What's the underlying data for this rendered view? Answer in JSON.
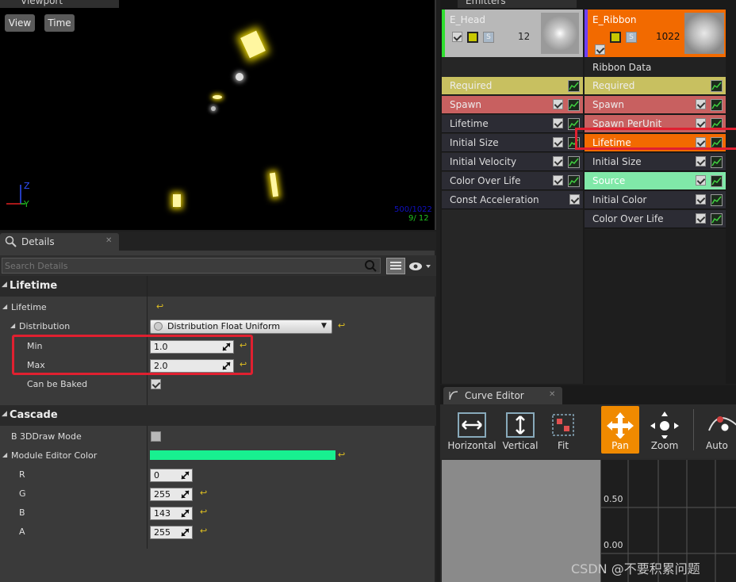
{
  "viewport": {
    "tab": "Viewport",
    "view_btn": "View",
    "time_btn": "Time",
    "stat_line1": "500/1022",
    "stat_line2": "9/ 12",
    "axis_z": "Z",
    "axis_y": "Y"
  },
  "details": {
    "tab": "Details",
    "search_placeholder": "Search Details",
    "lifetime_section": "Lifetime",
    "lifetime_label": "Lifetime",
    "distribution_label": "Distribution",
    "distribution_value": "Distribution Float Uniform",
    "min_label": "Min",
    "min_value": "1.0",
    "max_label": "Max",
    "max_value": "2.0",
    "baked_label": "Can be Baked",
    "cascade_section": "Cascade",
    "draw3d_label": "B 3DDraw Mode",
    "editor_color_label": "Module Editor Color",
    "editor_color": "#18f090",
    "r_label": "R",
    "r_value": "0",
    "g_label": "G",
    "g_value": "255",
    "b_label": "B",
    "b_value": "143",
    "a_label": "A",
    "a_value": "255"
  },
  "emitters": {
    "tab": "Emitters",
    "head": {
      "name": "E_Head",
      "count": "12",
      "rows": [
        "Required",
        "Spawn",
        "Lifetime",
        "Initial Size",
        "Initial Velocity",
        "Color Over Life",
        "Const Acceleration"
      ]
    },
    "ribbon": {
      "name": "E_Ribbon",
      "count": "1022",
      "data_label": "Ribbon Data",
      "rows": [
        "Required",
        "Spawn",
        "Spawn PerUnit",
        "Lifetime",
        "Initial Size",
        "Source",
        "Initial Color",
        "Color Over Life"
      ]
    }
  },
  "curve_editor": {
    "tab": "Curve Editor",
    "buttons": [
      "Horizontal",
      "Vertical",
      "Fit",
      "Pan",
      "Zoom",
      "Auto"
    ],
    "y_labels": [
      "0.50",
      "0.00"
    ]
  },
  "watermark": "CSDN @不要积累问题"
}
